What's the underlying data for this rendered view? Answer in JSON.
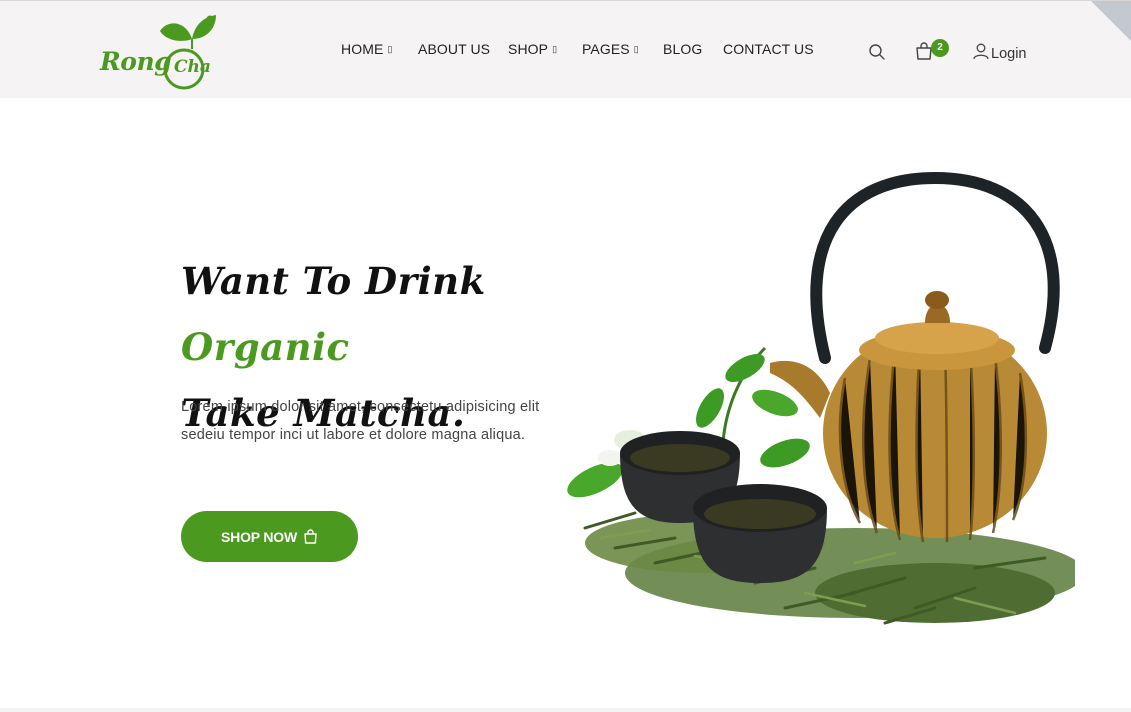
{
  "brand": {
    "name_part1": "Rong",
    "name_part2": "Cha",
    "color": "#4b9a1f"
  },
  "nav": {
    "items": [
      {
        "label": "HOME",
        "dropdown": true
      },
      {
        "label": "ABOUT US",
        "dropdown": false
      },
      {
        "label": "SHOP",
        "dropdown": true
      },
      {
        "label": "PAGES",
        "dropdown": true
      },
      {
        "label": "BLOG",
        "dropdown": false
      },
      {
        "label": "CONTACT US",
        "dropdown": false
      }
    ],
    "caret": "▯"
  },
  "header_actions": {
    "search_icon": "search-icon",
    "cart_icon": "shopping-bag-icon",
    "cart_count": "2",
    "login_icon": "user-icon",
    "login_label": "Login"
  },
  "hero": {
    "title_part1": "Want To Drink ",
    "title_highlight": "Organic",
    "title_line2": "Take Matcha.",
    "description": "Lorem ipsum dolor sit amet, consectetu adipisicing elit sedeiu tempor inci ut labore et dolore magna aliqua.",
    "button_label": "SHOP NOW",
    "button_icon": "shopping-bag-icon",
    "image": "teapot-and-tea-cups-image"
  },
  "colors": {
    "accent": "#4b9a1f",
    "header_bg": "#f6f3f5",
    "text": "#111111"
  }
}
